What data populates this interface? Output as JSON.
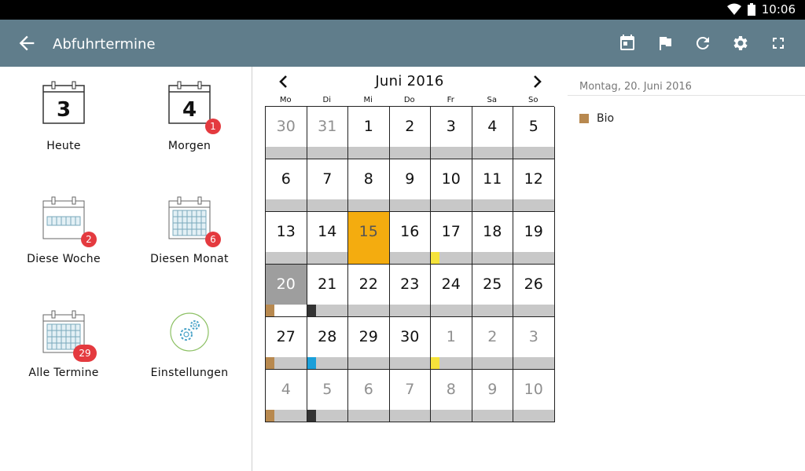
{
  "status": {
    "time": "10:06"
  },
  "appbar": {
    "title": "Abfuhrtermine",
    "icons": [
      "back-arrow-icon",
      "calendar-today-icon",
      "flag-icon",
      "refresh-icon",
      "settings-icon",
      "fullscreen-icon"
    ]
  },
  "tiles": [
    {
      "label": "Heute",
      "icon": "calendar-day-icon",
      "day": "3",
      "badge": ""
    },
    {
      "label": "Morgen",
      "icon": "calendar-day-icon",
      "day": "4",
      "badge": "1"
    },
    {
      "label": "Diese Woche",
      "icon": "calendar-week-icon",
      "day": "",
      "badge": "2"
    },
    {
      "label": "Diesen Monat",
      "icon": "calendar-month-icon",
      "day": "",
      "badge": "6"
    },
    {
      "label": "Alle Termine",
      "icon": "calendar-all-icon",
      "day": "",
      "badge": "29"
    },
    {
      "label": "Einstellungen",
      "icon": "gears-icon",
      "day": "",
      "badge": ""
    }
  ],
  "calendar": {
    "title": "Juni 2016",
    "weekdays": [
      "Mo",
      "Di",
      "Mi",
      "Do",
      "Fr",
      "Sa",
      "So"
    ],
    "days": [
      {
        "n": "30",
        "out": true
      },
      {
        "n": "31",
        "out": true
      },
      {
        "n": "1"
      },
      {
        "n": "2"
      },
      {
        "n": "3"
      },
      {
        "n": "4"
      },
      {
        "n": "5"
      },
      {
        "n": "6"
      },
      {
        "n": "7"
      },
      {
        "n": "8"
      },
      {
        "n": "9"
      },
      {
        "n": "10"
      },
      {
        "n": "11"
      },
      {
        "n": "12"
      },
      {
        "n": "13"
      },
      {
        "n": "14"
      },
      {
        "n": "15",
        "today": true
      },
      {
        "n": "16"
      },
      {
        "n": "17",
        "mark": "yellow"
      },
      {
        "n": "18"
      },
      {
        "n": "19"
      },
      {
        "n": "20",
        "selected": true,
        "mark": "brown"
      },
      {
        "n": "21",
        "mark": "black"
      },
      {
        "n": "22"
      },
      {
        "n": "23"
      },
      {
        "n": "24"
      },
      {
        "n": "25"
      },
      {
        "n": "26"
      },
      {
        "n": "27",
        "mark": "brown"
      },
      {
        "n": "28",
        "mark": "blue"
      },
      {
        "n": "29"
      },
      {
        "n": "30"
      },
      {
        "n": "1",
        "out": true,
        "mark": "yellow"
      },
      {
        "n": "2",
        "out": true
      },
      {
        "n": "3",
        "out": true
      },
      {
        "n": "4",
        "out": true,
        "mark": "brown"
      },
      {
        "n": "5",
        "out": true,
        "mark": "black"
      },
      {
        "n": "6",
        "out": true
      },
      {
        "n": "7",
        "out": true
      },
      {
        "n": "8",
        "out": true
      },
      {
        "n": "9",
        "out": true
      },
      {
        "n": "10",
        "out": true
      }
    ]
  },
  "colors": {
    "appbar": "#607d8b",
    "today": "#f4ac0f",
    "selected": "#9e9e9e",
    "badge": "#e43a3f",
    "brown": "#b8894f",
    "black": "#333333",
    "blue": "#1a9fd9",
    "yellow": "#f5e33b"
  },
  "details": {
    "date": "Montag, 20. Juni 2016",
    "items": [
      {
        "label": "Bio",
        "color": "brown"
      }
    ]
  }
}
